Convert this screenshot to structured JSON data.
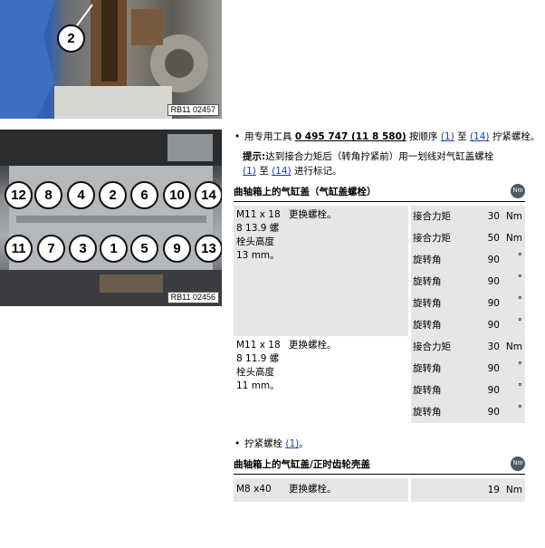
{
  "figures": {
    "top": {
      "code": "RB11 02457",
      "bolt_label": "2"
    },
    "cylinder_head": {
      "code": "RB11 02456",
      "top_row": [
        "12",
        "8",
        "4",
        "2",
        "6",
        "10",
        "14"
      ],
      "bottom_row": [
        "11",
        "7",
        "3",
        "1",
        "5",
        "9",
        "13"
      ]
    }
  },
  "instructions": {
    "step1": {
      "prefix": "用专用工具 ",
      "tool": "0 495 747 (11 8 580)",
      "mid": " 按顺序 ",
      "from": "(1)",
      "to_word": " 至 ",
      "to": "(14)",
      "suffix": " 拧紧螺栓。"
    },
    "note": {
      "label": "提示:",
      "line1": "达到接合力矩后（转角拧紧前）用一划线对气缸盖螺栓",
      "from": "(1)",
      "to_word": " 至 ",
      "to": "(14)",
      "suffix": " 进行标记。"
    },
    "step2": {
      "prefix": "拧紧螺栓 ",
      "ref": "(1)",
      "suffix": "。"
    }
  },
  "section1": {
    "title": "曲轴箱上的气缸盖（气缸盖螺栓）",
    "icon": "Nm",
    "groups": [
      {
        "spec_lines": [
          "M11 x 18",
          "8 13.9 螺",
          "栓头高度",
          "13 mm。"
        ],
        "description": "更换螺栓。",
        "rows": [
          {
            "label": "接合力矩",
            "value": "30",
            "unit": "Nm"
          },
          {
            "label": "接合力矩",
            "value": "50",
            "unit": "Nm"
          },
          {
            "label": "旋转角",
            "value": "90",
            "unit": "°"
          },
          {
            "label": "旋转角",
            "value": "90",
            "unit": "°"
          },
          {
            "label": "旋转角",
            "value": "90",
            "unit": "°"
          },
          {
            "label": "旋转角",
            "value": "90",
            "unit": "°"
          }
        ]
      },
      {
        "spec_lines": [
          "M11 x 18",
          "8 11.9 螺",
          "栓头高度",
          "11 mm。"
        ],
        "description": "更换螺栓。",
        "rows": [
          {
            "label": "接合力矩",
            "value": "30",
            "unit": "Nm"
          },
          {
            "label": "旋转角",
            "value": "90",
            "unit": "°"
          },
          {
            "label": "旋转角",
            "value": "90",
            "unit": "°"
          },
          {
            "label": "旋转角",
            "value": "90",
            "unit": "°"
          }
        ]
      }
    ]
  },
  "section2": {
    "title": "曲轴箱上的气缸盖/正时齿轮壳盖",
    "icon": "Nm",
    "row": {
      "spec": "M8 x40",
      "description": "更换螺栓。",
      "value": "19",
      "unit": "Nm"
    }
  }
}
